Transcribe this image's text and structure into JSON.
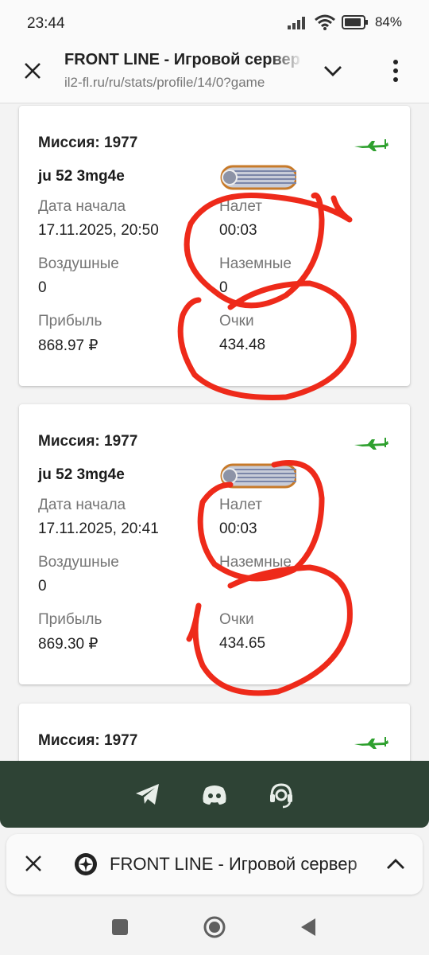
{
  "status_bar": {
    "time": "23:44",
    "battery": "84%"
  },
  "browser": {
    "title": "FRONT LINE - Игровой сервер",
    "url": "il2-fl.ru/ru/stats/profile/14/0?game"
  },
  "colors": {
    "accent_green": "#2ea02e",
    "scribble_red": "#ee2a1a",
    "social_bar_bg": "#2e4335"
  },
  "cards": [
    {
      "mission": "Миссия: 1977",
      "aircraft": "ju 52 3mg4e",
      "start_label": "Дата начала",
      "start_value": "17.11.2025, 20:50",
      "flight_label": "Налет",
      "flight_value": "00:03",
      "air_label": "Воздушные",
      "air_value": "0",
      "ground_label": "Наземные",
      "ground_value": "0",
      "profit_label": "Прибыль",
      "profit_value": "868.97 ₽",
      "score_label": "Очки",
      "score_value": "434.48"
    },
    {
      "mission": "Миссия: 1977",
      "aircraft": "ju 52 3mg4e",
      "start_label": "Дата начала",
      "start_value": "17.11.2025, 20:41",
      "flight_label": "Налет",
      "flight_value": "00:03",
      "air_label": "Воздушные",
      "air_value": "0",
      "ground_label": "Наземные",
      "ground_value": "",
      "profit_label": "Прибыль",
      "profit_value": "869.30 ₽",
      "score_label": "Очки",
      "score_value": "434.65"
    },
    {
      "mission": "Миссия: 1977"
    }
  ],
  "social": [
    "telegram-icon",
    "discord-icon",
    "support-headset-icon"
  ],
  "tab": {
    "title": "FRONT LINE - Игровой сервер"
  },
  "nav": [
    "recents-icon",
    "home-icon",
    "back-icon"
  ]
}
